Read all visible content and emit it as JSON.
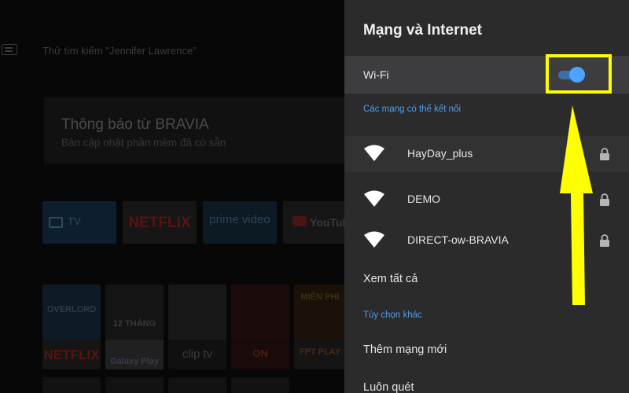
{
  "home": {
    "search_hint": "Thử tìm kiếm \"Jennifer Lawrence\"",
    "icons": {
      "keyboard": "keyboard-icon",
      "tv": "tv-icon",
      "youtube": "youtube-play-icon"
    },
    "notification": {
      "title": "Thông báo từ BRAVIA",
      "subtitle": "Bản cập nhật phần mềm đã có sẵn"
    },
    "apps": [
      {
        "label": "TV"
      },
      {
        "label": "NETFLIX"
      },
      {
        "label": "prime video"
      },
      {
        "label": "YouTube"
      }
    ],
    "channel_tiles": [
      {
        "label": "NETFLIX"
      },
      {
        "label": "Galaxy Play"
      },
      {
        "label": "clip tv"
      },
      {
        "label": "ON"
      },
      {
        "label": "FPT PLAY"
      }
    ],
    "thumb_texts": [
      {
        "text": "OVERLORD"
      },
      {
        "text": "12 THÁNG"
      },
      {
        "text": "MIỀN PHI"
      }
    ]
  },
  "panel": {
    "title": "Mạng và Internet",
    "wifi": {
      "label": "Wi-Fi",
      "enabled": true,
      "highlight_color": "#ffff00"
    },
    "connectable_header": "Các mạng có thể kết nối",
    "networks": [
      {
        "name": "HayDay_plus",
        "secured": true,
        "icon": "wifi-icon",
        "lock_icon": "lock-icon"
      },
      {
        "name": "DEMO",
        "secured": true,
        "icon": "wifi-icon",
        "lock_icon": "lock-icon"
      },
      {
        "name": "DIRECT-ow-BRAVIA",
        "secured": true,
        "icon": "wifi-icon",
        "lock_icon": "lock-icon"
      }
    ],
    "see_all": "Xem tất cả",
    "other_options_header": "Tùy chọn khác",
    "add_network": "Thêm mạng mới",
    "always_scan": "Luôn quét"
  },
  "colors": {
    "panel_bg": "#2b2b2c",
    "accent_blue": "#4d9eef",
    "toggle_on": "#4da3ff",
    "annotation_yellow": "#ffff00"
  }
}
